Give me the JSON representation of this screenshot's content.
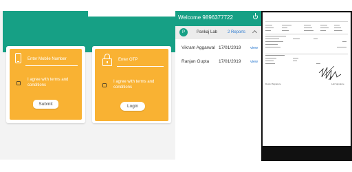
{
  "login": {
    "mobile_placeholder": "Enter Mobile Number",
    "agree_text": "I agree with terms and conditions",
    "submit_label": "Submit",
    "otp_placeholder": "Enter OTP",
    "agree_text_2": "I agree with terms and conditions",
    "login_label": "Login"
  },
  "reports_panel": {
    "welcome": "Welcome 9896377722",
    "lab": {
      "avatar_letter": "P",
      "name": "Pankaj Lab",
      "reports": "2 Reports"
    },
    "patients": [
      {
        "name": "Vikram Aggarwal",
        "date": "17/01/2019",
        "action": "view"
      },
      {
        "name": "Ranjan Gupta",
        "date": "17/01/2019",
        "action": "view"
      }
    ]
  },
  "document": {
    "left_signature_label": "Doctor Signature",
    "right_signature_label": "Lab Signature"
  },
  "colors": {
    "teal": "#16a085",
    "orange": "#f9b233",
    "link_blue": "#2d7bd1"
  }
}
